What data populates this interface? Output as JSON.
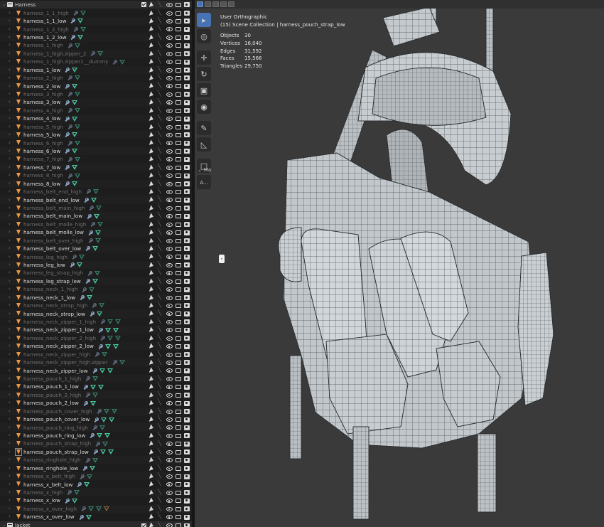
{
  "outliner": {
    "collection_top": "Harness",
    "collection_bottom": "Jacket",
    "rows": [
      {
        "name": "harness_1_1_high",
        "kind": "high",
        "extra_mesh": 0
      },
      {
        "name": "harness_1_1_low",
        "kind": "low",
        "extra_mesh": 0
      },
      {
        "name": "harness_1_2_high",
        "kind": "high",
        "extra_mesh": 0
      },
      {
        "name": "harness_1_2_low",
        "kind": "low",
        "extra_mesh": 0
      },
      {
        "name": "harness_1_high",
        "kind": "high",
        "extra_mesh": 0
      },
      {
        "name": "harness_1_high.zipper_2",
        "kind": "high",
        "extra_mesh": 0
      },
      {
        "name": "harness_1_high.zipper1__dummy",
        "kind": "high",
        "extra_mesh": 0
      },
      {
        "name": "harness_1_low",
        "kind": "low",
        "extra_mesh": 0
      },
      {
        "name": "harness_2_high",
        "kind": "high",
        "extra_mesh": 0
      },
      {
        "name": "harness_2_low",
        "kind": "low",
        "extra_mesh": 0
      },
      {
        "name": "harness_3_high",
        "kind": "high",
        "extra_mesh": 0
      },
      {
        "name": "harness_3_low",
        "kind": "low",
        "extra_mesh": 0
      },
      {
        "name": "harness_4_high",
        "kind": "high",
        "extra_mesh": 0
      },
      {
        "name": "harness_4_low",
        "kind": "low",
        "extra_mesh": 0
      },
      {
        "name": "harness_5_high",
        "kind": "high",
        "extra_mesh": 0
      },
      {
        "name": "harness_5_low",
        "kind": "low",
        "extra_mesh": 0
      },
      {
        "name": "harness_6_high",
        "kind": "high",
        "extra_mesh": 0
      },
      {
        "name": "harness_6_low",
        "kind": "low",
        "extra_mesh": 0
      },
      {
        "name": "harness_7_high",
        "kind": "high",
        "extra_mesh": 0
      },
      {
        "name": "harness_7_low",
        "kind": "low",
        "extra_mesh": 0
      },
      {
        "name": "harness_8_high",
        "kind": "high",
        "extra_mesh": 0
      },
      {
        "name": "harness_8_low",
        "kind": "low",
        "extra_mesh": 0
      },
      {
        "name": "harness_belt_end_high",
        "kind": "high",
        "extra_mesh": 0
      },
      {
        "name": "harness_belt_end_low",
        "kind": "low",
        "extra_mesh": 0
      },
      {
        "name": "harness_belt_main_high",
        "kind": "high",
        "extra_mesh": 0
      },
      {
        "name": "harness_belt_main_low",
        "kind": "low",
        "extra_mesh": 0
      },
      {
        "name": "harness_belt_molle_high",
        "kind": "high",
        "extra_mesh": 0
      },
      {
        "name": "harness_belt_molle_low",
        "kind": "low",
        "extra_mesh": 0
      },
      {
        "name": "harness_belt_over_high",
        "kind": "high",
        "extra_mesh": 0
      },
      {
        "name": "harness_belt_over_low",
        "kind": "low",
        "extra_mesh": 0
      },
      {
        "name": "harness_leg_high",
        "kind": "high",
        "extra_mesh": 0
      },
      {
        "name": "harness_leg_low",
        "kind": "low",
        "extra_mesh": 0
      },
      {
        "name": "harness_leg_strap_high",
        "kind": "high",
        "extra_mesh": 0
      },
      {
        "name": "harness_leg_strap_low",
        "kind": "low",
        "extra_mesh": 0
      },
      {
        "name": "harness_neck_1_high",
        "kind": "high",
        "extra_mesh": 0
      },
      {
        "name": "harness_neck_1_low",
        "kind": "low",
        "extra_mesh": 0
      },
      {
        "name": "harness_neck_strap_high",
        "kind": "high",
        "extra_mesh": 0
      },
      {
        "name": "harness_neck_strap_low",
        "kind": "low",
        "extra_mesh": 0
      },
      {
        "name": "harness_neck_zipper_1_high",
        "kind": "high",
        "extra_mesh": 1
      },
      {
        "name": "harness_neck_zipper_1_low",
        "kind": "low",
        "extra_mesh": 1
      },
      {
        "name": "harness_neck_zipper_2_high",
        "kind": "high",
        "extra_mesh": 1
      },
      {
        "name": "harness_neck_zipper_2_low",
        "kind": "low",
        "extra_mesh": 1
      },
      {
        "name": "harness_neck_zipper_high",
        "kind": "high",
        "extra_mesh": 0
      },
      {
        "name": "harness_neck_zipper_high.zipper",
        "kind": "high",
        "extra_mesh": 0
      },
      {
        "name": "harness_neck_zipper_low",
        "kind": "low",
        "extra_mesh": 1
      },
      {
        "name": "harness_pouch_1_high",
        "kind": "high",
        "extra_mesh": 0
      },
      {
        "name": "harness_pouch_1_low",
        "kind": "low",
        "extra_mesh": 1
      },
      {
        "name": "harness_pouch_2_high",
        "kind": "high",
        "extra_mesh": 0
      },
      {
        "name": "harness_pouch_2_low",
        "kind": "low",
        "extra_mesh": 0
      },
      {
        "name": "harness_pouch_cover_high",
        "kind": "high",
        "extra_mesh": 1
      },
      {
        "name": "harness_pouch_cover_low",
        "kind": "low",
        "extra_mesh": 1
      },
      {
        "name": "harness_pouch_ring_high",
        "kind": "high",
        "extra_mesh": 0
      },
      {
        "name": "harness_pouch_ring_low",
        "kind": "low",
        "extra_mesh": 1
      },
      {
        "name": "harness_pouch_strap_high",
        "kind": "high",
        "extra_mesh": 0
      },
      {
        "name": "harness_pouch_strap_low",
        "kind": "low",
        "extra_mesh": 1,
        "selected": true
      },
      {
        "name": "harness_ringhole_high",
        "kind": "high",
        "extra_mesh": 0
      },
      {
        "name": "harness_ringhole_low",
        "kind": "low",
        "extra_mesh": 0
      },
      {
        "name": "harness_x_belt_high",
        "kind": "high",
        "extra_mesh": 0
      },
      {
        "name": "harness_x_belt_low",
        "kind": "low",
        "extra_mesh": 0
      },
      {
        "name": "harness_x_high",
        "kind": "high",
        "extra_mesh": 0
      },
      {
        "name": "harness_x_low",
        "kind": "low",
        "extra_mesh": 0
      },
      {
        "name": "harness_x_over_high",
        "kind": "high",
        "extra_mesh": 2
      },
      {
        "name": "harness_x_over_low",
        "kind": "low",
        "extra_mesh": 0
      }
    ]
  },
  "viewport": {
    "view_name": "User Orthographic",
    "collection_info": "(15) Scene Collection | harness_pouch_strap_low",
    "stats": [
      {
        "label": "Objects",
        "value": "30"
      },
      {
        "label": "Vertices",
        "value": "16,040"
      },
      {
        "label": "Edges",
        "value": "31,592"
      },
      {
        "label": "Faces",
        "value": "15,566"
      },
      {
        "label": "Triangles",
        "value": "29,750"
      }
    ],
    "panel_toggle_label": "Ma",
    "panel_button_label": "A..."
  },
  "colors": {
    "mesh_teal": "#48c7a0",
    "object_orange": "#e8954a",
    "wrench_blue": "#8da4c4",
    "active_tool": "#4772b3"
  },
  "icons": {
    "tools": [
      "select-box-icon",
      "cursor-icon",
      "move-icon",
      "rotate-icon",
      "scale-icon",
      "transform-icon",
      "annotate-icon",
      "measure-icon",
      "add-cube-icon",
      "extrude-icon"
    ]
  }
}
